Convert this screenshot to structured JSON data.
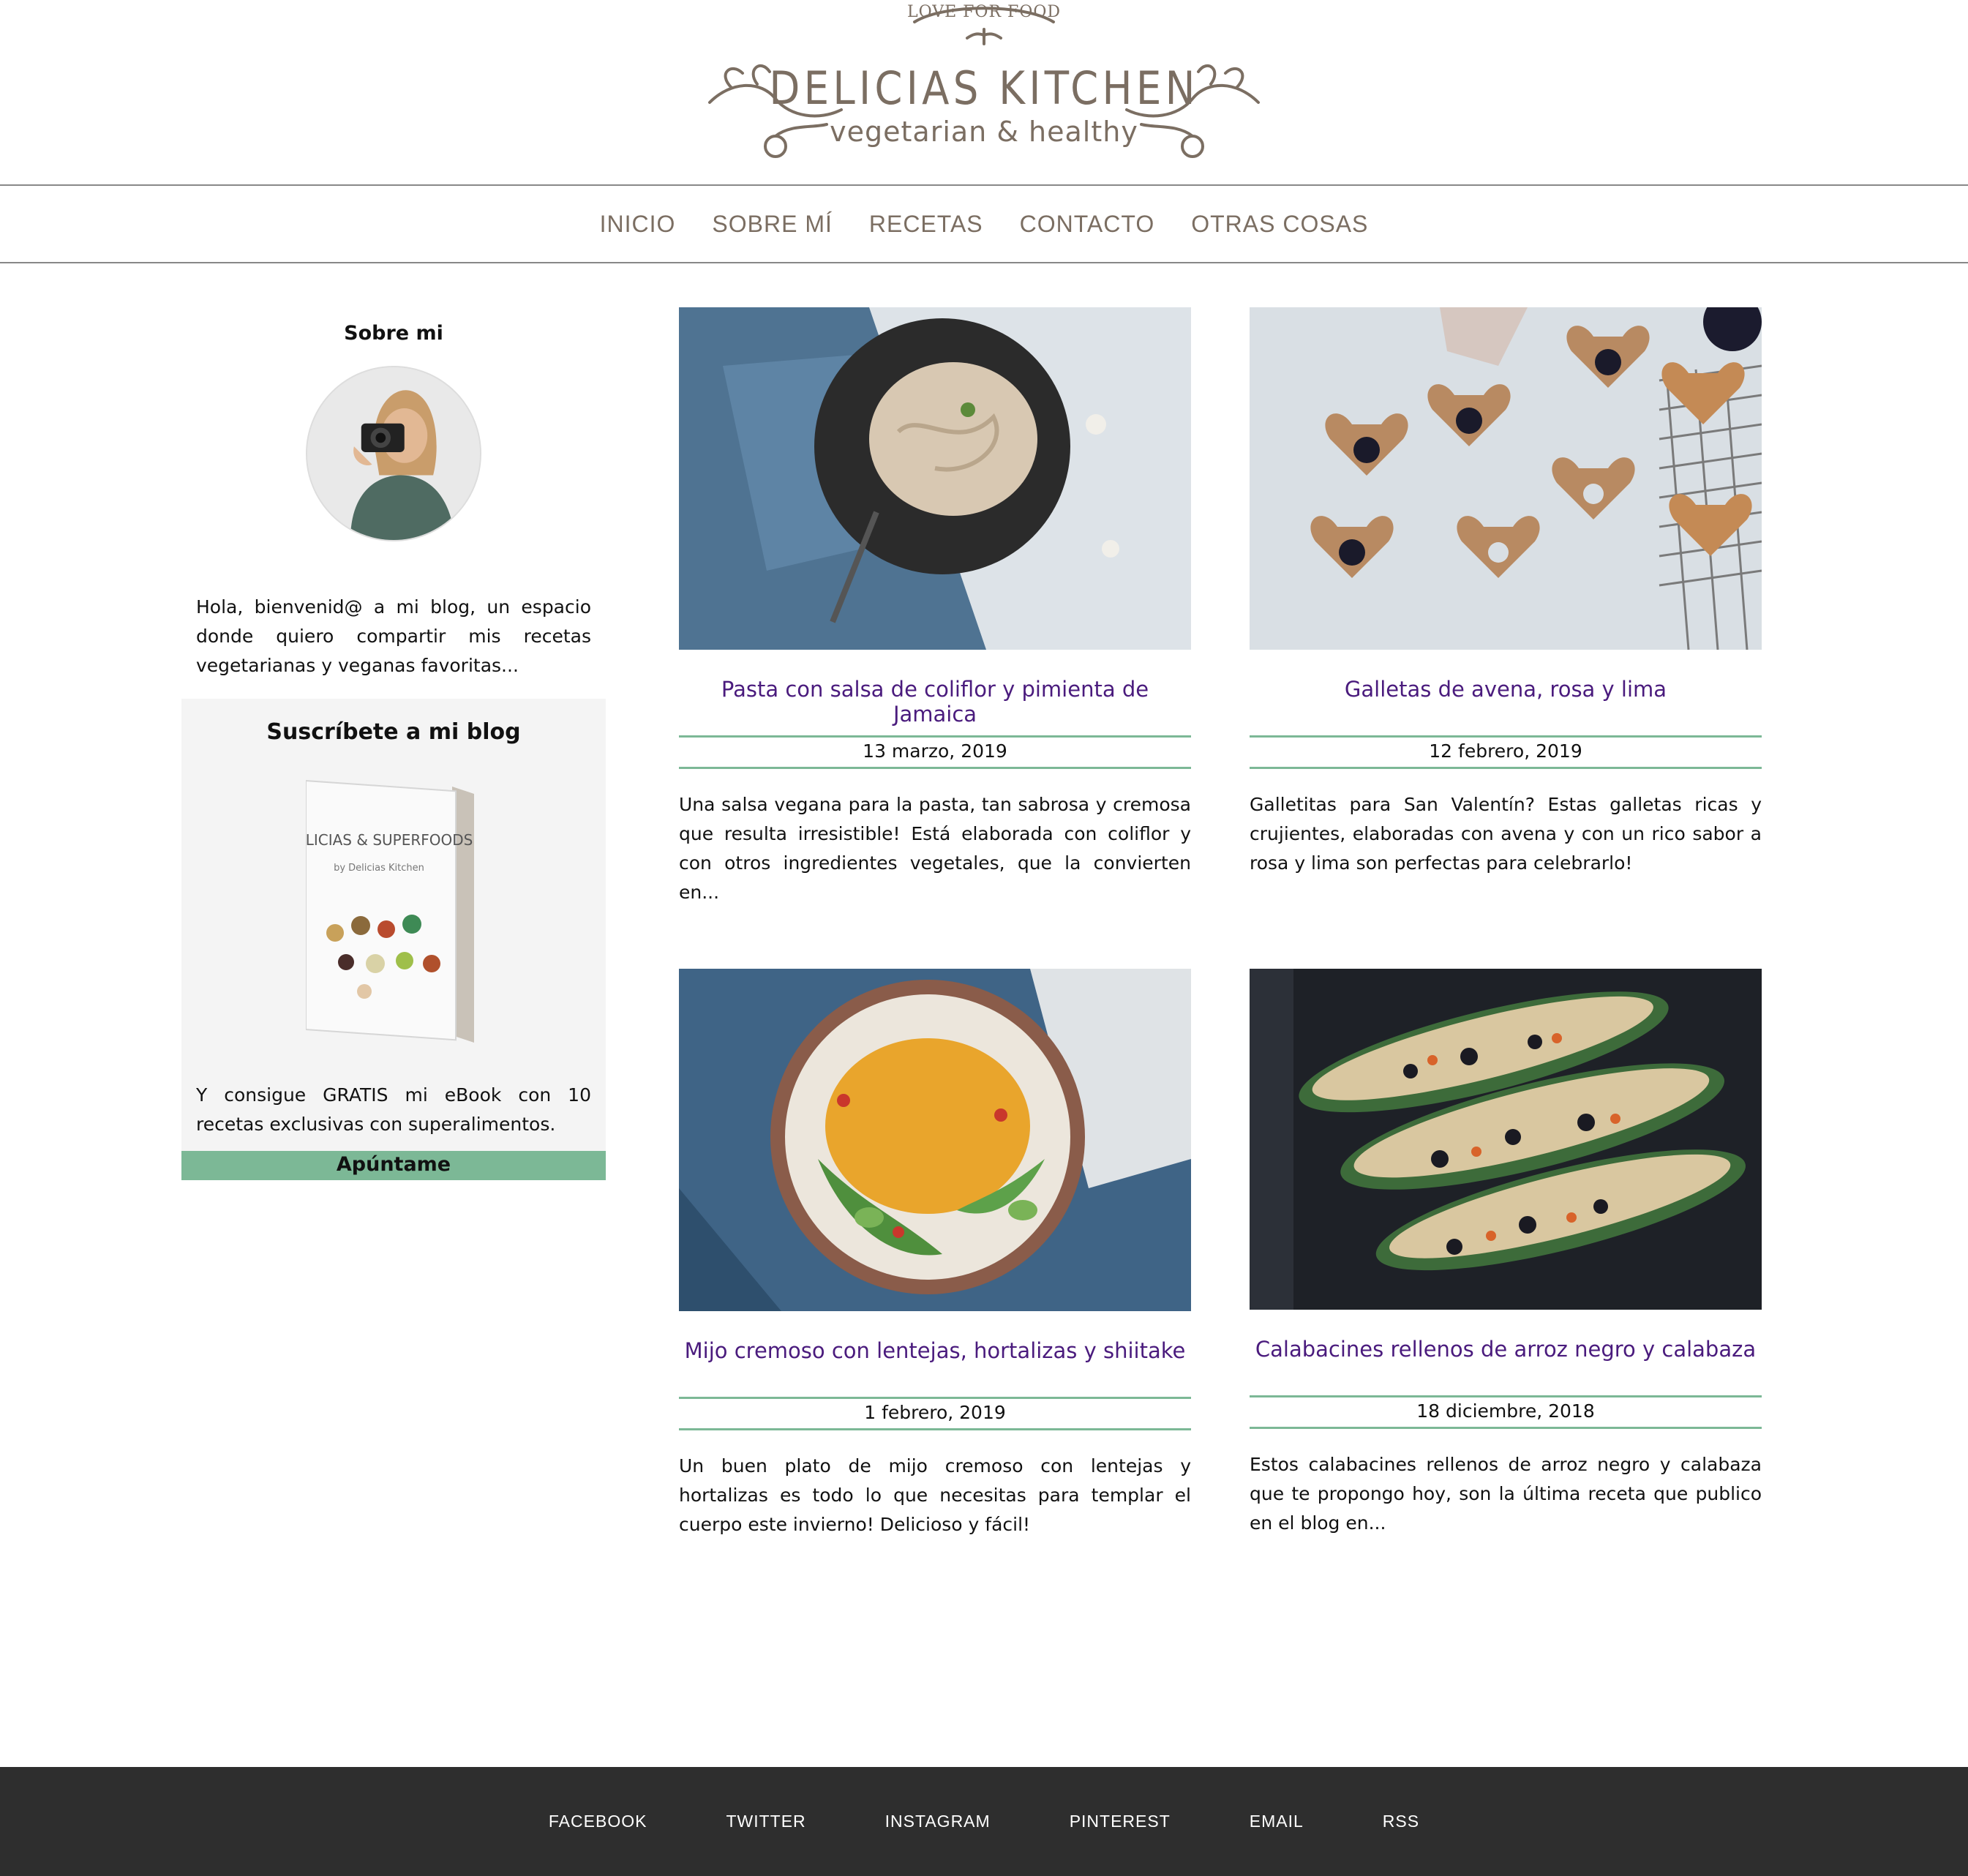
{
  "logo": {
    "top": "LOVE FOR FOOD",
    "main": "DELICIAS KITCHEN",
    "sub": "vegetarian & healthy"
  },
  "nav": {
    "items": [
      "INICIO",
      "SOBRE MÍ",
      "RECETAS",
      "CONTACTO",
      "OTRAS COSAS"
    ]
  },
  "sidebar": {
    "title": "Sobre mi",
    "bio": "Hola, bienvenid@ a mi blog, un espacio donde quiero compartir mis recetas vegetarianas y veganas favoritas...",
    "subscribe": {
      "title": "Suscríbete a mi blog",
      "ebook_title": "DELICIAS & SUPERFOODS",
      "ebook_by": "by Delicias Kitchen",
      "text": "Y consigue GRATIS mi eBook con 10 recetas exclusivas con superalimentos.",
      "button": "Apúntame"
    }
  },
  "posts": [
    {
      "title": "Pasta con salsa de coliflor y pimienta de Jamaica",
      "date": "13 marzo, 2019",
      "excerpt": "Una salsa vegana para la pasta, tan sabrosa y cremosa que resulta irresistible! Está elaborada con coliflor y con otros ingredientes vegetales, que la convierten en..."
    },
    {
      "title": "Galletas de avena, rosa y lima",
      "date": "12 febrero, 2019",
      "excerpt": "Galletitas para San Valentín? Estas galletas ricas y crujientes, elaboradas con avena y con un rico sabor a rosa y lima son perfectas para celebrarlo!"
    },
    {
      "title": "Mijo cremoso con lentejas, hortalizas y shiitake",
      "date": "1 febrero, 2019",
      "excerpt": "Un buen plato de mijo cremoso con lentejas y hortalizas es todo lo que necesitas para templar el cuerpo este invierno! Delicioso y fácil!"
    },
    {
      "title": "Calabacines rellenos de arroz negro y calabaza",
      "date": "18 diciembre, 2018",
      "excerpt": "Estos calabacines rellenos de arroz negro y calabaza que te propongo hoy, son la última receta que publico en el blog en..."
    }
  ],
  "footer": {
    "links": [
      "FACEBOOK",
      "TWITTER",
      "INSTAGRAM",
      "PINTEREST",
      "EMAIL",
      "RSS"
    ]
  },
  "colors": {
    "accent": "#7cb896",
    "title_purple": "#4a1b7d",
    "logo_brown": "#7b6e62",
    "footer_bg": "#2e2e2e"
  }
}
